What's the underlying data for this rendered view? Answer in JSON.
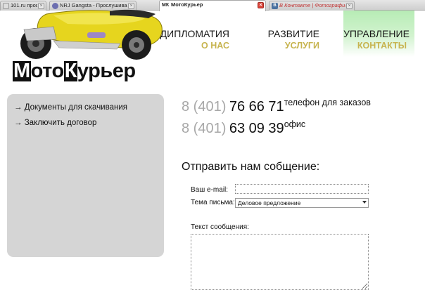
{
  "browser": {
    "tabs": [
      {
        "title": "101.ru профес...",
        "favicon": "generic-page-icon"
      },
      {
        "title": "NRJ Gangsta - Прослушивание канала",
        "favicon": "nrj-radio-icon"
      },
      {
        "title": "МотоКурьер",
        "favicon": "mk-site-icon",
        "favicon_text": "МК",
        "active": true
      },
      {
        "title": "В Контакте | Фотографии",
        "favicon": "vk-icon",
        "favicon_text": "В"
      }
    ]
  },
  "logo": {
    "part1_box": "М",
    "part1_rest": "ото",
    "part2_box": "К",
    "part2_rest": "урьер"
  },
  "nav": [
    {
      "main": "ДИПЛОМАТИЯ",
      "sub": "О НАС"
    },
    {
      "main": "РАЗВИТИЕ",
      "sub": "УСЛУГИ"
    },
    {
      "main": "УПРАВЛЕНИЕ",
      "sub": "КОНТАКТЫ",
      "active": true
    }
  ],
  "sidebar": {
    "links": [
      "→ Документы для скачивания",
      "→ Заключить договор"
    ]
  },
  "phones": [
    {
      "code": "8 (401)",
      "number": "76 66 71",
      "note": "телефон для заказов"
    },
    {
      "code": "8 (401)",
      "number": "63 09 39",
      "note": "офис"
    }
  ],
  "form": {
    "title": "Отправить нам собщение:",
    "email_label": "Ваш e-mail:",
    "email_value": "",
    "subject_label": "Тема письма:",
    "subject_value": "Деловое предложение",
    "message_label": "Текст сообщения:"
  },
  "colors": {
    "nav_sub": "#c7b44f",
    "active_nav_bg": "#b7ecb5",
    "sidebar_bg": "#d5d5d5",
    "phone_code": "#a8a8a8"
  }
}
